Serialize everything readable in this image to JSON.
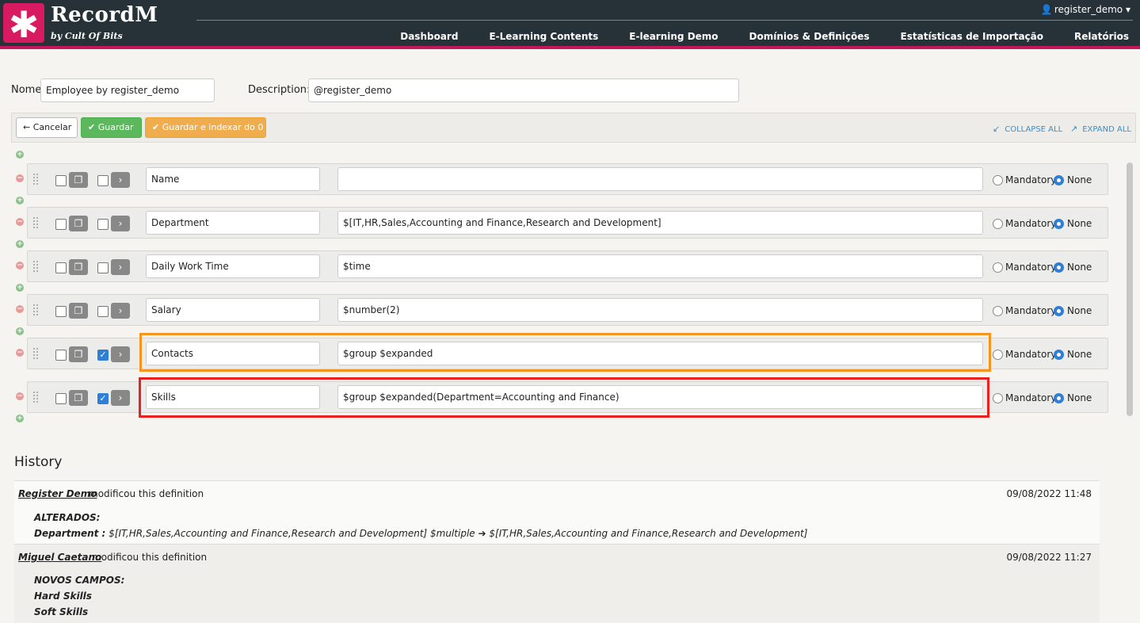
{
  "brand": {
    "name": "RecordM",
    "byline": "by Cult Of Bits",
    "logo_glyph": "✱"
  },
  "user": {
    "name": "register_demo",
    "icon": "person-icon",
    "caret": "▾"
  },
  "nav": [
    "Dashboard",
    "E-Learning Contents",
    "E-learning Demo",
    "Domínios & Definições",
    "Estatísticas de Importação",
    "Relatórios"
  ],
  "form": {
    "name_label": "Nome",
    "name_value": "Employee by register_demo",
    "description_label": "Description:",
    "description_value": "@register_demo"
  },
  "toolbar": {
    "cancel": "Cancelar",
    "save": "Guardar",
    "save_index": "Guardar e indexar do 0",
    "collapse_all": "COLLAPSE ALL",
    "expand_all": "EXPAND ALL"
  },
  "radio_labels": {
    "mandatory": "Mandatory",
    "none": "None"
  },
  "fields": [
    {
      "name": "Name",
      "description": "",
      "checked": false,
      "required": "None"
    },
    {
      "name": "Department",
      "description": "$[IT,HR,Sales,Accounting and Finance,Research and Development]",
      "checked": false,
      "required": "None"
    },
    {
      "name": "Daily Work Time",
      "description": "$time",
      "checked": false,
      "required": "None"
    },
    {
      "name": "Salary",
      "description": "$number(2)",
      "checked": false,
      "required": "None"
    },
    {
      "name": "Contacts",
      "description": "$group $expanded",
      "checked": true,
      "required": "None"
    },
    {
      "name": "Skills",
      "description": "$group $expanded(Department=Accounting and Finance)",
      "checked": true,
      "required": "None"
    }
  ],
  "history": {
    "title": "History",
    "entries": [
      {
        "author": "Register Demo",
        "action": "modificou this definition",
        "date": "09/08/2022 11:48",
        "section": "ALTERADOS:",
        "field": "Department :",
        "old": "$[IT,HR,Sales,Accounting and Finance,Research and Development] $multiple",
        "new": "$[IT,HR,Sales,Accounting and Finance,Research and Development]"
      },
      {
        "author": "Miguel Caetano",
        "action": "modificou this definition",
        "date": "09/08/2022 11:27",
        "section": "NOVOS CAMPOS:",
        "items": [
          "Hard Skills",
          "Soft Skills"
        ]
      }
    ]
  },
  "colors": {
    "header_bg": "#263238",
    "accent": "#d81b60",
    "link": "#3a8ec8",
    "highlight_orange": "#f7941d",
    "highlight_red": "#e8201f"
  }
}
